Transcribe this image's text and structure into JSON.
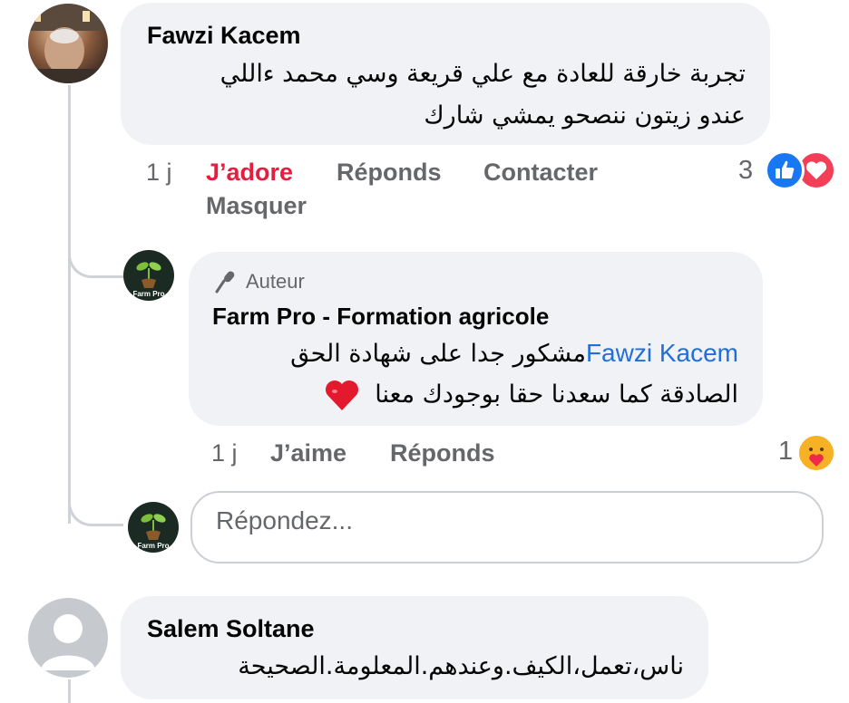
{
  "comments": [
    {
      "author": "Fawzi Kacem",
      "text_line1": "تجربة خارقة للعادة مع علي قريعة وسي محمد ءاللي",
      "text_line2": "عندو زيتون ننصحو يمشي شارك",
      "time": "1 j",
      "actions": {
        "like": "J’adore",
        "reply": "Réponds",
        "contact": "Contacter",
        "hide": "Masquer"
      },
      "reaction_count": "3",
      "reaction_icons": [
        "like-icon",
        "love-icon"
      ],
      "like_color": "#e41e3f",
      "reply": {
        "badge": "Auteur",
        "author": "Farm Pro - Formation agricole",
        "mention": "Fawzi Kacem",
        "text_line1": "مشكور جدا على شهادة الحق",
        "text_line2": "الصادقة كما سعدنا حقا بوجودك معنا",
        "emoji": "❤️",
        "avatar_label": "Farm Pro",
        "time": "1 j",
        "actions": {
          "like": "J’aime",
          "reply": "Réponds"
        },
        "reaction_count": "1",
        "reaction_icons": [
          "care-icon"
        ]
      },
      "reply_box": {
        "placeholder": "Répondez...",
        "avatar_label": "Farm Pro"
      }
    },
    {
      "author": "Salem Soltane",
      "text_line1": "ناس،تعمل،الكيف.وعندهم.المعلومة.الصحيحة"
    }
  ],
  "colors": {
    "mention": "#216fdb",
    "secondary_text": "#65676b",
    "bubble": "#f0f2f5",
    "like_blue": "#1877f2"
  }
}
